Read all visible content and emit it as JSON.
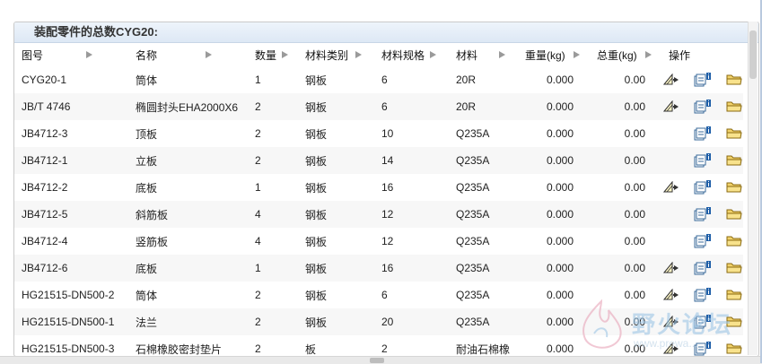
{
  "panel": {
    "title": "装配零件的总数CYG20:"
  },
  "columns": [
    {
      "label": "图号",
      "sortable": true
    },
    {
      "label": "名称",
      "sortable": true
    },
    {
      "label": "数量",
      "sortable": true
    },
    {
      "label": "材料类别",
      "sortable": true
    },
    {
      "label": "材料规格",
      "sortable": true
    },
    {
      "label": "材料",
      "sortable": true
    },
    {
      "label": "重量(kg)",
      "sortable": true
    },
    {
      "label": "总重(kg)",
      "sortable": true
    },
    {
      "label": "操作",
      "sortable": false
    }
  ],
  "rows": [
    {
      "code": "CYG20-1",
      "name": "筒体",
      "qty": "1",
      "mat_type": "钢板",
      "spec": "6",
      "material": "20R",
      "weight": "0.000",
      "total": "0.00",
      "edit": true
    },
    {
      "code": "JB/T 4746",
      "name": "椭圆封头EHA2000X6",
      "qty": "2",
      "mat_type": "钢板",
      "spec": "6",
      "material": "20R",
      "weight": "0.000",
      "total": "0.00",
      "edit": true
    },
    {
      "code": "JB4712-3",
      "name": "顶板",
      "qty": "2",
      "mat_type": "钢板",
      "spec": "10",
      "material": "Q235A",
      "weight": "0.000",
      "total": "0.00",
      "edit": false
    },
    {
      "code": "JB4712-1",
      "name": "立板",
      "qty": "2",
      "mat_type": "钢板",
      "spec": "14",
      "material": "Q235A",
      "weight": "0.000",
      "total": "0.00",
      "edit": false
    },
    {
      "code": "JB4712-2",
      "name": "底板",
      "qty": "1",
      "mat_type": "钢板",
      "spec": "16",
      "material": "Q235A",
      "weight": "0.000",
      "total": "0.00",
      "edit": true
    },
    {
      "code": "JB4712-5",
      "name": "斜筋板",
      "qty": "4",
      "mat_type": "钢板",
      "spec": "12",
      "material": "Q235A",
      "weight": "0.000",
      "total": "0.00",
      "edit": false
    },
    {
      "code": "JB4712-4",
      "name": "竖筋板",
      "qty": "4",
      "mat_type": "钢板",
      "spec": "12",
      "material": "Q235A",
      "weight": "0.000",
      "total": "0.00",
      "edit": false
    },
    {
      "code": "JB4712-6",
      "name": "底板",
      "qty": "1",
      "mat_type": "钢板",
      "spec": "16",
      "material": "Q235A",
      "weight": "0.000",
      "total": "0.00",
      "edit": true
    },
    {
      "code": "HG21515-DN500-2",
      "name": "筒体",
      "qty": "2",
      "mat_type": "钢板",
      "spec": "6",
      "material": "Q235A",
      "weight": "0.000",
      "total": "0.00",
      "edit": true
    },
    {
      "code": "HG21515-DN500-1",
      "name": "法兰",
      "qty": "2",
      "mat_type": "钢板",
      "spec": "20",
      "material": "Q235A",
      "weight": "0.000",
      "total": "0.00",
      "edit": true
    },
    {
      "code": "HG21515-DN500-3",
      "name": "石棉橡胶密封垫片",
      "qty": "2",
      "mat_type": "板",
      "spec": "2",
      "material": "耐油石棉橡",
      "weight": "0.000",
      "total": "0.00",
      "edit": true
    }
  ],
  "watermark": {
    "text": "野火论坛",
    "url": "www.prewa..."
  },
  "colors": {
    "header_bg": "#dde8f5",
    "alt_row": "#f7f7f7",
    "sort_arrow": "#9a9a9a"
  }
}
